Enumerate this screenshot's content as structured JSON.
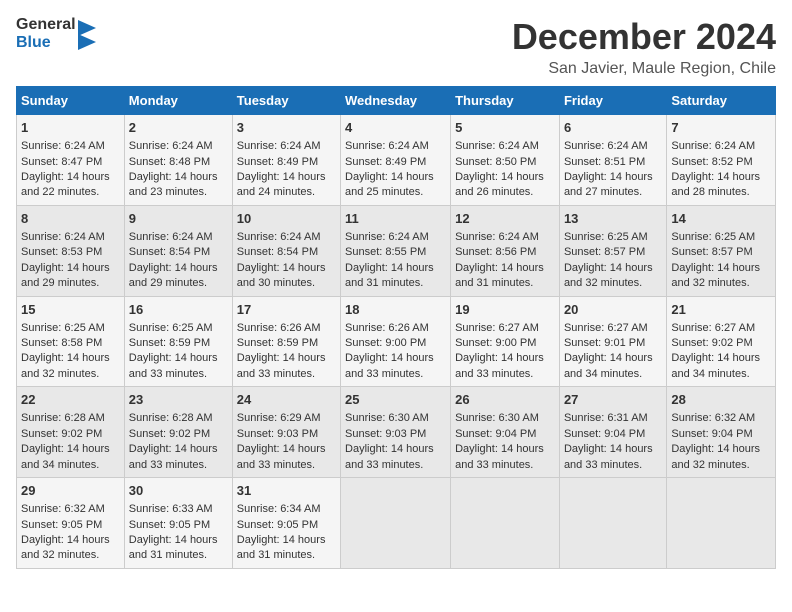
{
  "header": {
    "logo_general": "General",
    "logo_blue": "Blue",
    "month_title": "December 2024",
    "location": "San Javier, Maule Region, Chile"
  },
  "weekdays": [
    "Sunday",
    "Monday",
    "Tuesday",
    "Wednesday",
    "Thursday",
    "Friday",
    "Saturday"
  ],
  "weeks": [
    [
      {
        "day": "1",
        "sunrise": "Sunrise: 6:24 AM",
        "sunset": "Sunset: 8:47 PM",
        "daylight": "Daylight: 14 hours and 22 minutes."
      },
      {
        "day": "2",
        "sunrise": "Sunrise: 6:24 AM",
        "sunset": "Sunset: 8:48 PM",
        "daylight": "Daylight: 14 hours and 23 minutes."
      },
      {
        "day": "3",
        "sunrise": "Sunrise: 6:24 AM",
        "sunset": "Sunset: 8:49 PM",
        "daylight": "Daylight: 14 hours and 24 minutes."
      },
      {
        "day": "4",
        "sunrise": "Sunrise: 6:24 AM",
        "sunset": "Sunset: 8:49 PM",
        "daylight": "Daylight: 14 hours and 25 minutes."
      },
      {
        "day": "5",
        "sunrise": "Sunrise: 6:24 AM",
        "sunset": "Sunset: 8:50 PM",
        "daylight": "Daylight: 14 hours and 26 minutes."
      },
      {
        "day": "6",
        "sunrise": "Sunrise: 6:24 AM",
        "sunset": "Sunset: 8:51 PM",
        "daylight": "Daylight: 14 hours and 27 minutes."
      },
      {
        "day": "7",
        "sunrise": "Sunrise: 6:24 AM",
        "sunset": "Sunset: 8:52 PM",
        "daylight": "Daylight: 14 hours and 28 minutes."
      }
    ],
    [
      {
        "day": "8",
        "sunrise": "Sunrise: 6:24 AM",
        "sunset": "Sunset: 8:53 PM",
        "daylight": "Daylight: 14 hours and 29 minutes."
      },
      {
        "day": "9",
        "sunrise": "Sunrise: 6:24 AM",
        "sunset": "Sunset: 8:54 PM",
        "daylight": "Daylight: 14 hours and 29 minutes."
      },
      {
        "day": "10",
        "sunrise": "Sunrise: 6:24 AM",
        "sunset": "Sunset: 8:54 PM",
        "daylight": "Daylight: 14 hours and 30 minutes."
      },
      {
        "day": "11",
        "sunrise": "Sunrise: 6:24 AM",
        "sunset": "Sunset: 8:55 PM",
        "daylight": "Daylight: 14 hours and 31 minutes."
      },
      {
        "day": "12",
        "sunrise": "Sunrise: 6:24 AM",
        "sunset": "Sunset: 8:56 PM",
        "daylight": "Daylight: 14 hours and 31 minutes."
      },
      {
        "day": "13",
        "sunrise": "Sunrise: 6:25 AM",
        "sunset": "Sunset: 8:57 PM",
        "daylight": "Daylight: 14 hours and 32 minutes."
      },
      {
        "day": "14",
        "sunrise": "Sunrise: 6:25 AM",
        "sunset": "Sunset: 8:57 PM",
        "daylight": "Daylight: 14 hours and 32 minutes."
      }
    ],
    [
      {
        "day": "15",
        "sunrise": "Sunrise: 6:25 AM",
        "sunset": "Sunset: 8:58 PM",
        "daylight": "Daylight: 14 hours and 32 minutes."
      },
      {
        "day": "16",
        "sunrise": "Sunrise: 6:25 AM",
        "sunset": "Sunset: 8:59 PM",
        "daylight": "Daylight: 14 hours and 33 minutes."
      },
      {
        "day": "17",
        "sunrise": "Sunrise: 6:26 AM",
        "sunset": "Sunset: 8:59 PM",
        "daylight": "Daylight: 14 hours and 33 minutes."
      },
      {
        "day": "18",
        "sunrise": "Sunrise: 6:26 AM",
        "sunset": "Sunset: 9:00 PM",
        "daylight": "Daylight: 14 hours and 33 minutes."
      },
      {
        "day": "19",
        "sunrise": "Sunrise: 6:27 AM",
        "sunset": "Sunset: 9:00 PM",
        "daylight": "Daylight: 14 hours and 33 minutes."
      },
      {
        "day": "20",
        "sunrise": "Sunrise: 6:27 AM",
        "sunset": "Sunset: 9:01 PM",
        "daylight": "Daylight: 14 hours and 34 minutes."
      },
      {
        "day": "21",
        "sunrise": "Sunrise: 6:27 AM",
        "sunset": "Sunset: 9:02 PM",
        "daylight": "Daylight: 14 hours and 34 minutes."
      }
    ],
    [
      {
        "day": "22",
        "sunrise": "Sunrise: 6:28 AM",
        "sunset": "Sunset: 9:02 PM",
        "daylight": "Daylight: 14 hours and 34 minutes."
      },
      {
        "day": "23",
        "sunrise": "Sunrise: 6:28 AM",
        "sunset": "Sunset: 9:02 PM",
        "daylight": "Daylight: 14 hours and 33 minutes."
      },
      {
        "day": "24",
        "sunrise": "Sunrise: 6:29 AM",
        "sunset": "Sunset: 9:03 PM",
        "daylight": "Daylight: 14 hours and 33 minutes."
      },
      {
        "day": "25",
        "sunrise": "Sunrise: 6:30 AM",
        "sunset": "Sunset: 9:03 PM",
        "daylight": "Daylight: 14 hours and 33 minutes."
      },
      {
        "day": "26",
        "sunrise": "Sunrise: 6:30 AM",
        "sunset": "Sunset: 9:04 PM",
        "daylight": "Daylight: 14 hours and 33 minutes."
      },
      {
        "day": "27",
        "sunrise": "Sunrise: 6:31 AM",
        "sunset": "Sunset: 9:04 PM",
        "daylight": "Daylight: 14 hours and 33 minutes."
      },
      {
        "day": "28",
        "sunrise": "Sunrise: 6:32 AM",
        "sunset": "Sunset: 9:04 PM",
        "daylight": "Daylight: 14 hours and 32 minutes."
      }
    ],
    [
      {
        "day": "29",
        "sunrise": "Sunrise: 6:32 AM",
        "sunset": "Sunset: 9:05 PM",
        "daylight": "Daylight: 14 hours and 32 minutes."
      },
      {
        "day": "30",
        "sunrise": "Sunrise: 6:33 AM",
        "sunset": "Sunset: 9:05 PM",
        "daylight": "Daylight: 14 hours and 31 minutes."
      },
      {
        "day": "31",
        "sunrise": "Sunrise: 6:34 AM",
        "sunset": "Sunset: 9:05 PM",
        "daylight": "Daylight: 14 hours and 31 minutes."
      },
      null,
      null,
      null,
      null
    ]
  ]
}
